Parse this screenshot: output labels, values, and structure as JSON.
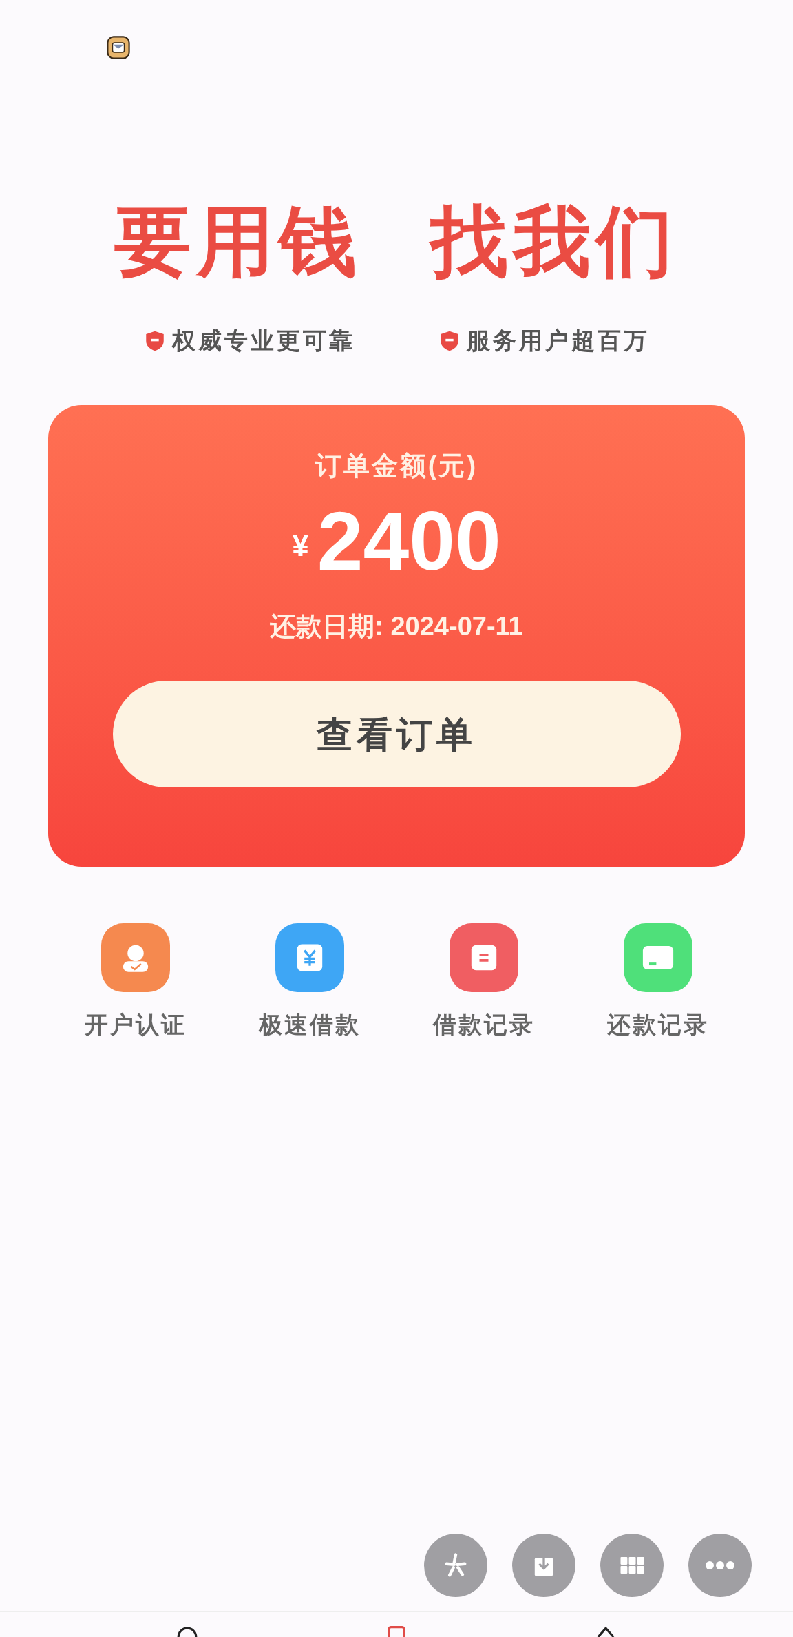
{
  "headline": [
    "要用钱",
    "找我们"
  ],
  "badges": [
    "权威专业更可靠",
    "服务用户超百万"
  ],
  "order_card": {
    "title": "订单金额(元)",
    "currency": "¥",
    "amount": "2400",
    "due_date": "还款日期: 2024-07-11",
    "button": "查看订单"
  },
  "shortcuts": [
    {
      "kind": "account",
      "label": "开户认证",
      "color": "#f5894f"
    },
    {
      "kind": "loan",
      "label": "极速借款",
      "color": "#3ea6f5"
    },
    {
      "kind": "loan-records",
      "label": "借款记录",
      "color": "#f05e62"
    },
    {
      "kind": "repay-records",
      "label": "还款记录",
      "color": "#4fe07a"
    }
  ],
  "floating_tools": [
    {
      "kind": "spark"
    },
    {
      "kind": "download"
    },
    {
      "kind": "grid"
    },
    {
      "kind": "more"
    }
  ]
}
